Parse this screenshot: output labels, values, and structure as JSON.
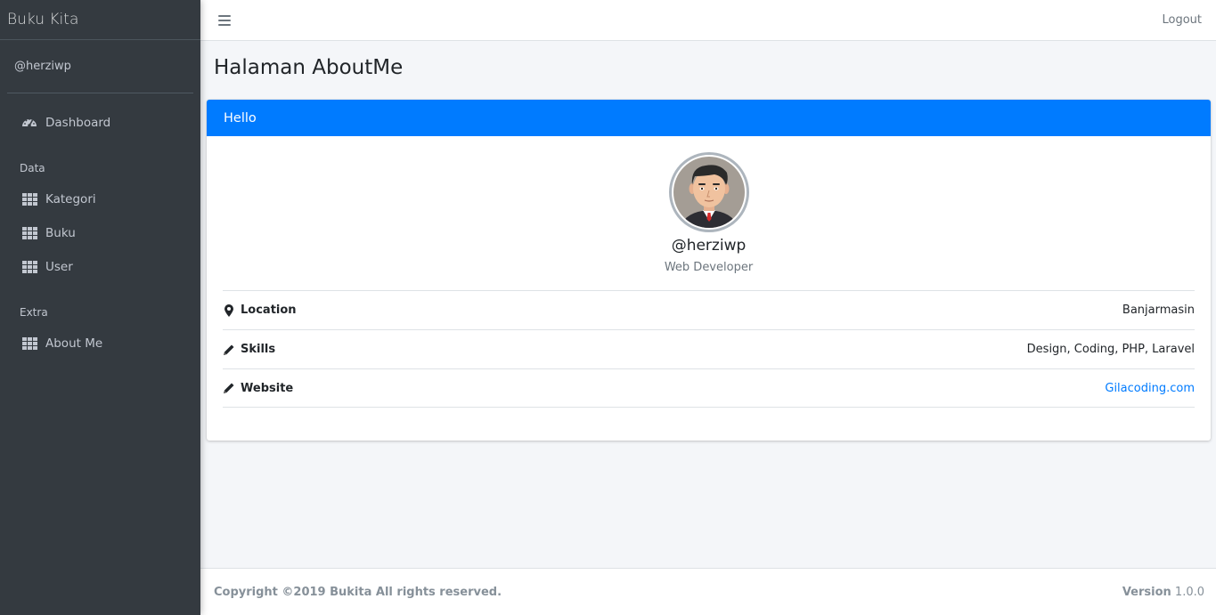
{
  "sidebar": {
    "brand": "Buku Kita",
    "user": "@herziwp",
    "items": [
      {
        "label": "Dashboard",
        "icon": "dashboard-gauge-icon"
      },
      {
        "header": "Data"
      },
      {
        "label": "Kategori",
        "icon": "table-grid-icon"
      },
      {
        "label": "Buku",
        "icon": "table-grid-icon"
      },
      {
        "label": "User",
        "icon": "table-grid-icon"
      },
      {
        "header": "Extra"
      },
      {
        "label": "About Me",
        "icon": "table-grid-icon"
      }
    ]
  },
  "topnav": {
    "logout_label": "Logout"
  },
  "page": {
    "title": "Halaman AboutMe"
  },
  "card": {
    "header": "Hello",
    "username": "@herziwp",
    "role": "Web Developer",
    "info": [
      {
        "label": "Location",
        "value": "Banjarmasin",
        "icon": "map-marker-icon"
      },
      {
        "label": "Skills",
        "value": "Design, Coding, PHP, Laravel",
        "icon": "pencil-icon"
      },
      {
        "label": "Website",
        "value": "Gilacoding.com",
        "icon": "pencil-icon"
      }
    ]
  },
  "footer": {
    "copyright": "Copyright ©2019 Bukita All rights reserved.",
    "version_label": "Version",
    "version_value": "1.0.0"
  },
  "colors": {
    "sidebar_bg": "#343a40",
    "primary": "#007bff",
    "content_bg": "#f4f6f9"
  }
}
